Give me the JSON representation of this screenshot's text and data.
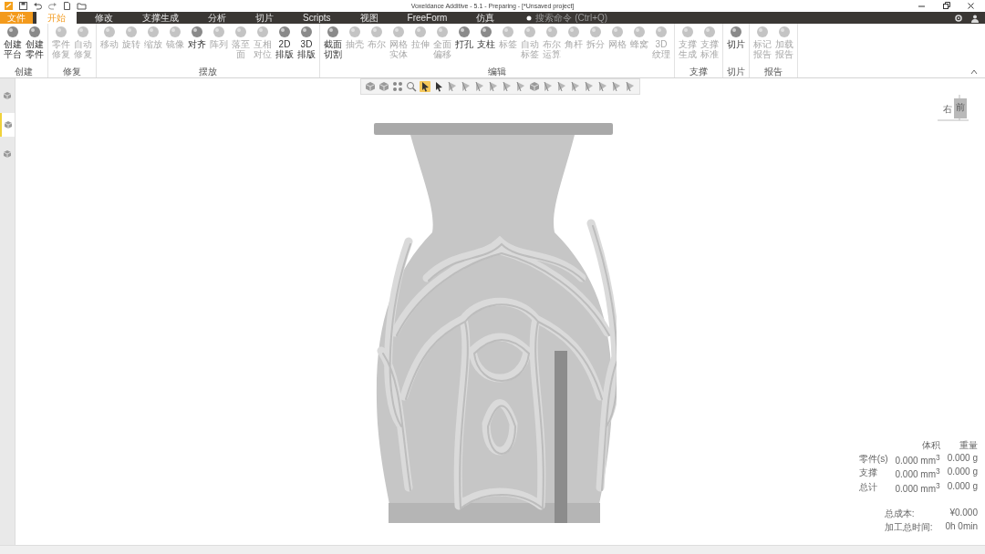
{
  "window": {
    "title": "Voxeldance Additive - 5.1 - Preparing - [*Unsaved project]"
  },
  "tabs": [
    {
      "label": "文件",
      "kind": "file",
      "selected": false
    },
    {
      "label": "开始",
      "kind": "tab",
      "selected": true
    },
    {
      "label": "修改",
      "kind": "tab",
      "selected": false
    },
    {
      "label": "支撑生成",
      "kind": "tab",
      "selected": false
    },
    {
      "label": "分析",
      "kind": "tab",
      "selected": false
    },
    {
      "label": "切片",
      "kind": "tab",
      "selected": false
    },
    {
      "label": "Scripts",
      "kind": "tab",
      "selected": false
    },
    {
      "label": "视图",
      "kind": "tab",
      "selected": false
    },
    {
      "label": "FreeForm",
      "kind": "tab",
      "selected": false
    },
    {
      "label": "仿真",
      "kind": "tab",
      "selected": false
    }
  ],
  "search": {
    "placeholder": "搜索命令 (Ctrl+Q)"
  },
  "ribbon": [
    {
      "group": "创建",
      "buttons": [
        {
          "label": "创建平台",
          "disabled": false
        },
        {
          "label": "创建零件",
          "disabled": false
        }
      ]
    },
    {
      "group": "修复",
      "buttons": [
        {
          "label": "零件修复",
          "disabled": true
        },
        {
          "label": "自动修复",
          "disabled": true
        }
      ]
    },
    {
      "group": "摆放",
      "buttons": [
        {
          "label": "移动",
          "disabled": true
        },
        {
          "label": "旋转",
          "disabled": true
        },
        {
          "label": "缩放",
          "disabled": true
        },
        {
          "label": "镜像",
          "disabled": true
        },
        {
          "label": "对齐",
          "disabled": false
        },
        {
          "label": "阵列",
          "disabled": true
        },
        {
          "label": "落至面",
          "disabled": true
        },
        {
          "label": "互相对位",
          "disabled": true
        },
        {
          "label": "2D排版",
          "disabled": false
        },
        {
          "label": "3D排版",
          "disabled": false
        }
      ]
    },
    {
      "group": "编辑",
      "buttons": [
        {
          "label": "截面切割",
          "disabled": false
        },
        {
          "label": "抽壳",
          "disabled": true
        },
        {
          "label": "布尔",
          "disabled": true
        },
        {
          "label": "网格实体",
          "disabled": true
        },
        {
          "label": "拉伸",
          "disabled": true
        },
        {
          "label": "全面偏移",
          "disabled": true
        },
        {
          "label": "打孔",
          "disabled": false
        },
        {
          "label": "支柱",
          "disabled": false
        },
        {
          "label": "标签",
          "disabled": true
        },
        {
          "label": "自动标签",
          "disabled": true
        },
        {
          "label": "布尔运算",
          "disabled": true
        },
        {
          "label": "角杆",
          "disabled": true
        },
        {
          "label": "拆分",
          "disabled": true
        },
        {
          "label": "网格",
          "disabled": true
        },
        {
          "label": "蜂窝",
          "disabled": true
        },
        {
          "label": "3D纹理",
          "disabled": true
        }
      ]
    },
    {
      "group": "支撑",
      "buttons": [
        {
          "label": "支撑生成",
          "disabled": true
        },
        {
          "label": "支撑标准",
          "disabled": true
        }
      ]
    },
    {
      "group": "切片",
      "buttons": [
        {
          "label": "切片",
          "disabled": false
        }
      ]
    },
    {
      "group": "报告",
      "buttons": [
        {
          "label": "标记报告",
          "disabled": true
        },
        {
          "label": "加载报告",
          "disabled": true
        }
      ]
    }
  ],
  "sidebar": [
    {
      "selected": false
    },
    {
      "selected": true
    },
    {
      "selected": false
    }
  ],
  "view_toolbar": [
    {
      "kind": "cube",
      "selected": false
    },
    {
      "kind": "cube",
      "selected": false
    },
    {
      "kind": "fit",
      "selected": false
    },
    {
      "kind": "search",
      "selected": false
    },
    {
      "kind": "cursor",
      "selected": true
    },
    {
      "kind": "cursor",
      "selected": false
    },
    {
      "kind": "face",
      "selected": false
    },
    {
      "kind": "face",
      "selected": false
    },
    {
      "kind": "face",
      "selected": false
    },
    {
      "kind": "face",
      "selected": false
    },
    {
      "kind": "face",
      "selected": false
    },
    {
      "kind": "face",
      "selected": false
    },
    {
      "kind": "cube",
      "selected": false
    },
    {
      "kind": "face",
      "selected": false
    },
    {
      "kind": "face",
      "selected": false
    },
    {
      "kind": "face",
      "selected": false
    },
    {
      "kind": "face",
      "selected": false
    },
    {
      "kind": "face",
      "selected": false
    },
    {
      "kind": "face",
      "selected": false
    },
    {
      "kind": "face",
      "selected": false
    }
  ],
  "view_cube": {
    "faces": [
      "右",
      "前"
    ]
  },
  "stats": {
    "columns": [
      "体积",
      "重量"
    ],
    "rows": [
      {
        "label": "零件(s)",
        "volume": "0.000 mm$^{3}$",
        "weight": "0.000 g"
      },
      {
        "label": "支撑",
        "volume": "0.000 mm$^{3}$",
        "weight": "0.000 g"
      },
      {
        "label": "总计",
        "volume": "0.000 mm$^{3}$",
        "weight": "0.000 g"
      }
    ],
    "totals": [
      {
        "label": "总成本:",
        "value": "¥0.000"
      },
      {
        "label": "加工总时间:",
        "value": "0h 0min"
      }
    ]
  }
}
